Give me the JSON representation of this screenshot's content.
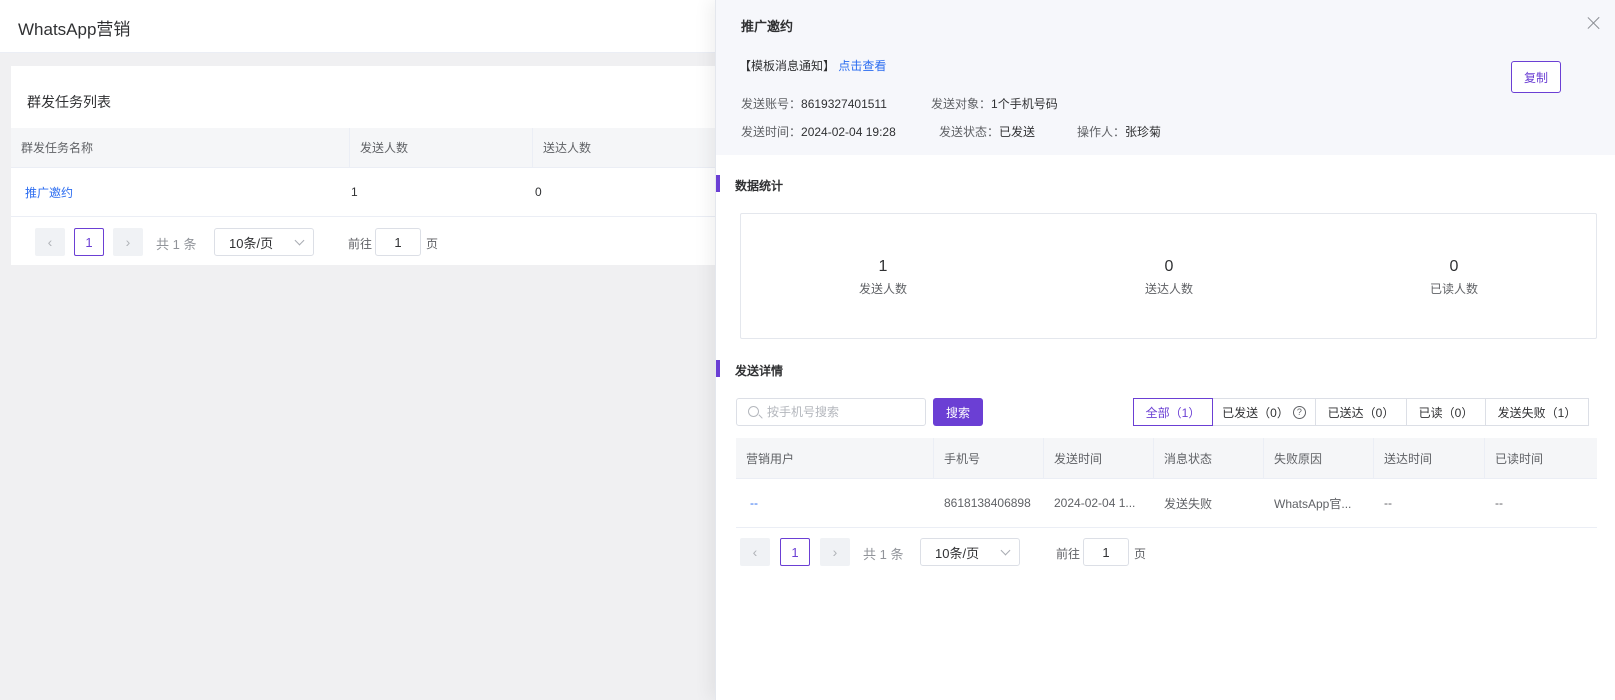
{
  "app": {
    "title": "WhatsApp营销"
  },
  "task_list": {
    "title": "群发任务列表",
    "columns": [
      "群发任务名称",
      "发送人数",
      "送达人数"
    ],
    "rows": [
      {
        "name": "推广邀约",
        "sent": "1",
        "delivered": "0"
      }
    ],
    "pagination": {
      "current": "1",
      "total": "共 1 条",
      "page_size": "10条/页",
      "goto_label": "前往",
      "goto_value": "1",
      "goto_unit": "页"
    }
  },
  "drawer": {
    "title": "推广邀约",
    "template_label": "【模板消息通知】",
    "view_link": "点击查看",
    "copy_button": "复制",
    "meta": {
      "account_label": "发送账号：",
      "account_value": "8619327401511",
      "target_label": "发送对象：",
      "target_value": "1个手机号码",
      "time_label": "发送时间：",
      "time_value": "2024-02-04 19:28",
      "status_label": "发送状态：",
      "status_value": "已发送",
      "operator_label": "操作人：",
      "operator_value": "张珍菊"
    },
    "stats_section": {
      "title": "数据统计",
      "items": [
        {
          "value": "1",
          "label": "发送人数"
        },
        {
          "value": "0",
          "label": "送达人数"
        },
        {
          "value": "0",
          "label": "已读人数"
        }
      ]
    },
    "detail_section": {
      "title": "发送详情",
      "search_placeholder": "按手机号搜索",
      "search_button": "搜索",
      "tabs": [
        {
          "label": "全部（1）"
        },
        {
          "label": "已发送（0）"
        },
        {
          "label": "已送达（0）"
        },
        {
          "label": "已读（0）"
        },
        {
          "label": "发送失败（1）"
        }
      ],
      "help_icon": "?",
      "columns": [
        "营销用户",
        "手机号",
        "发送时间",
        "消息状态",
        "失败原因",
        "送达时间",
        "已读时间"
      ],
      "rows": [
        {
          "user": "--",
          "phone": "8618138406898",
          "send_time": "2024-02-04 1...",
          "status": "发送失败",
          "reason": "WhatsApp官...",
          "delivered_time": "--",
          "read_time": "--"
        }
      ],
      "pagination": {
        "current": "1",
        "total": "共 1 条",
        "page_size": "10条/页",
        "goto_label": "前往",
        "goto_value": "1",
        "goto_unit": "页"
      }
    },
    "accent_color": "#6b3fd4",
    "link_color": "#2b6cf0"
  }
}
